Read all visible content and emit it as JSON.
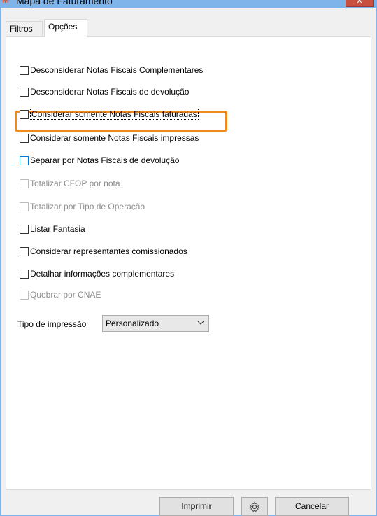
{
  "window": {
    "title": "Mapa de Faturamento",
    "close_label": "✕"
  },
  "tabs": [
    {
      "label": "Filtros"
    },
    {
      "label": "Opções",
      "selected": true
    }
  ],
  "options": [
    {
      "label": "Desconsiderar Notas Fiscais Complementares",
      "checked": false,
      "enabled": true
    },
    {
      "label": "Desconsiderar Notas Fiscais de devolução",
      "checked": false,
      "enabled": true
    },
    {
      "label": "Considerar somente Notas Fiscais faturadas",
      "checked": false,
      "enabled": true,
      "highlighted": true
    },
    {
      "label": "Considerar somente Notas Fiscais impressas",
      "checked": false,
      "enabled": true
    },
    {
      "label": "Separar por Notas Fiscais de devolução",
      "checked": false,
      "enabled": true
    },
    {
      "label": "Totalizar CFOP por nota",
      "checked": false,
      "enabled": false
    },
    {
      "label": "Totalizar por Tipo de Operação",
      "checked": false,
      "enabled": false
    },
    {
      "label": "Listar Fantasia",
      "checked": false,
      "enabled": true
    },
    {
      "label": "Considerar representantes comissionados",
      "checked": false,
      "enabled": true
    },
    {
      "label": "Detalhar informações complementares",
      "checked": false,
      "enabled": true
    },
    {
      "label": "Quebrar por CNAE",
      "checked": false,
      "enabled": false
    }
  ],
  "tipo_impressao": {
    "label": "Tipo de impressão",
    "value": "Personalizado"
  },
  "buttons": {
    "imprimir": "Imprimir",
    "settings_icon": "gear-icon",
    "cancelar": "Cancelar"
  },
  "colors": {
    "highlight": "#f08a1c",
    "titlebar": "#7eb4ea",
    "close": "#c7503e"
  }
}
